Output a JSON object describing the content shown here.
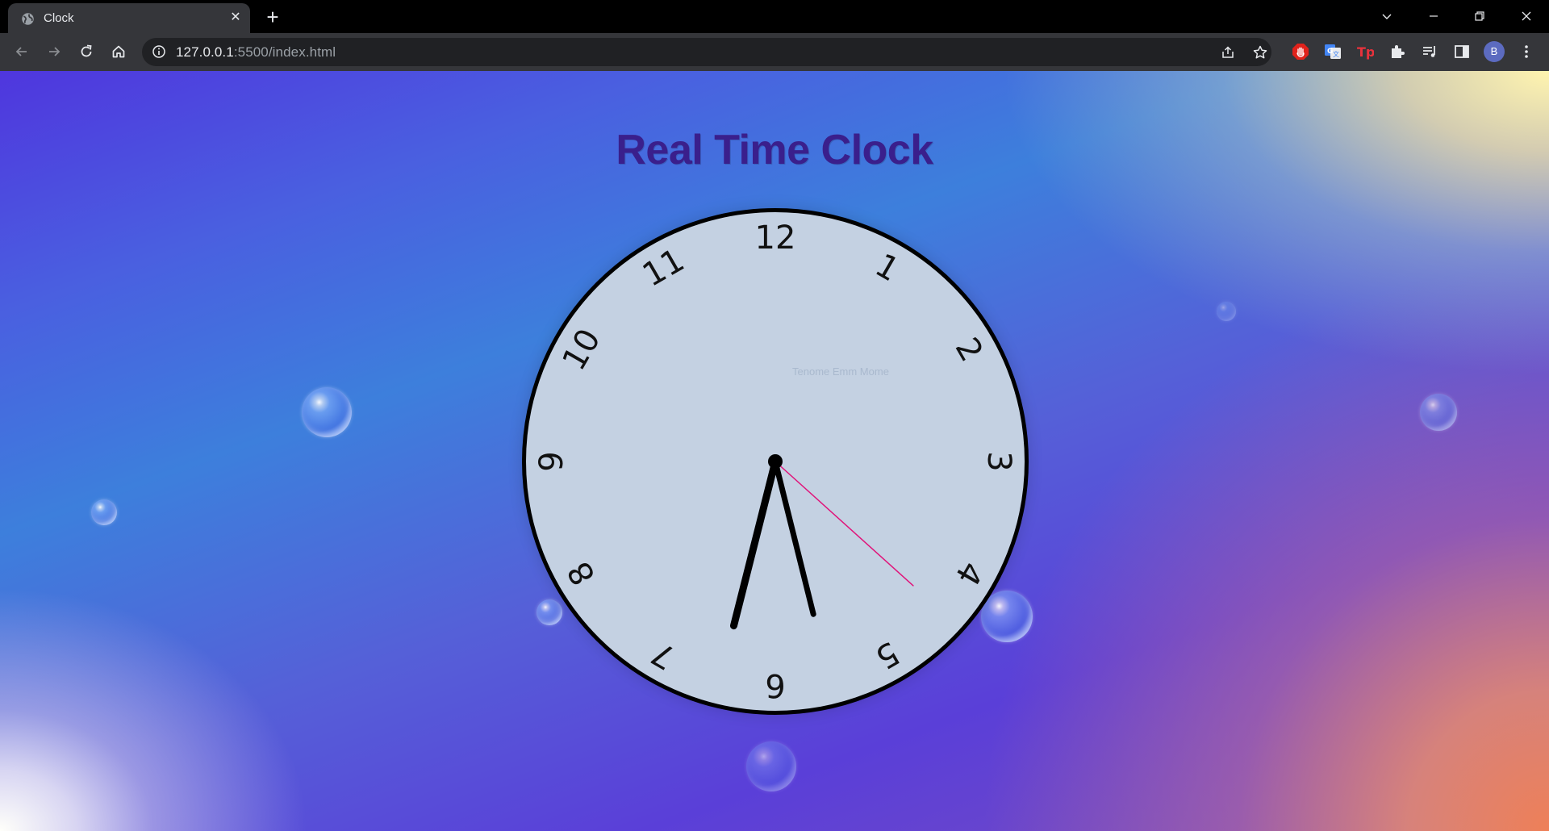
{
  "browser": {
    "tab_title": "Clock",
    "tab_close": "✕",
    "new_tab": "+",
    "url_host": "127.0.0.1",
    "url_path": ":5500/index.html",
    "profile_initial": "B"
  },
  "page": {
    "title": "Real Time Clock",
    "watermark": "Tenome Emm Mome"
  },
  "clock": {
    "numerals": [
      "12",
      "1",
      "2",
      "3",
      "4",
      "5",
      "6",
      "7",
      "8",
      "9",
      "10",
      "11"
    ],
    "time": {
      "hour": 5,
      "minute": 32,
      "second": 22
    },
    "colors": {
      "face": "#c4d1e2",
      "border": "#000000",
      "hands": "#000000",
      "second_hand": "#e0147a"
    }
  }
}
